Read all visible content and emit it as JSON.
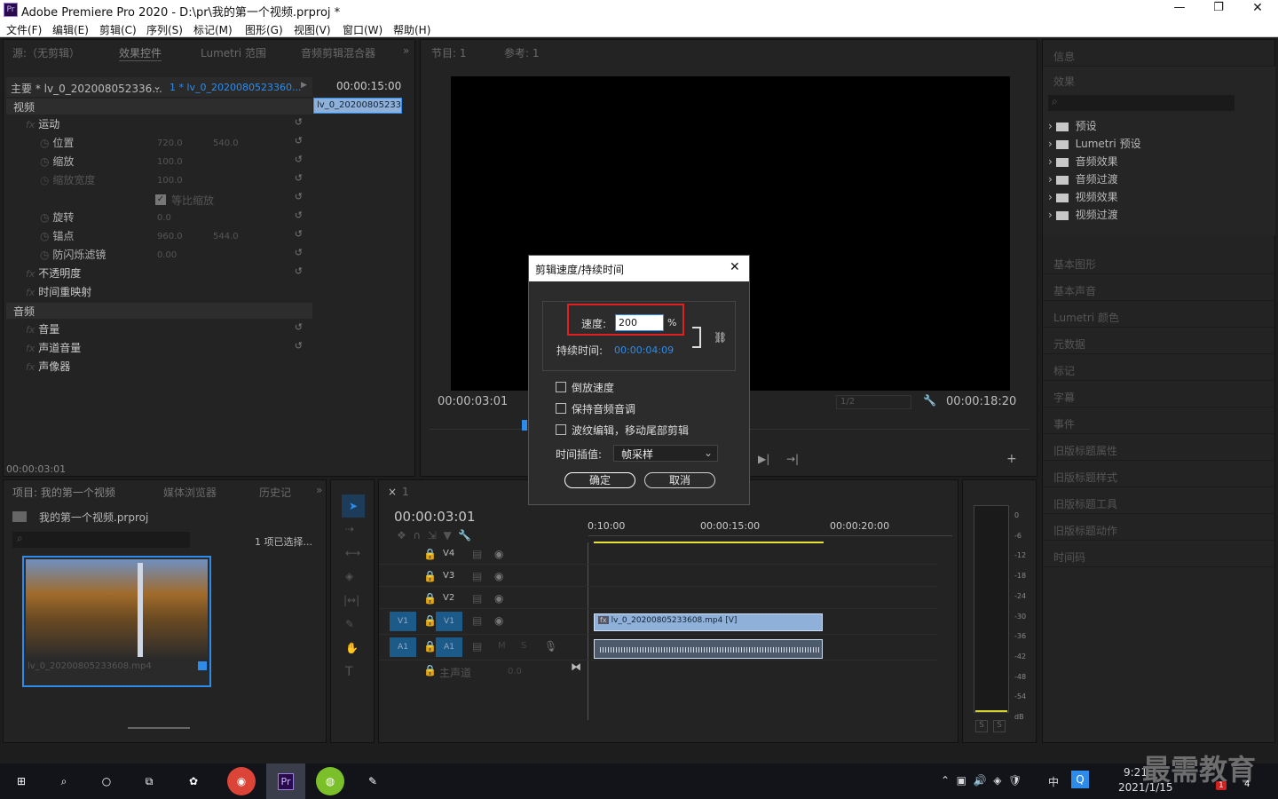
{
  "titlebar": {
    "app_icon": "Pr",
    "title": "Adobe Premiere Pro 2020 - D:\\pr\\我的第一个视频.prproj *",
    "min": "—",
    "max": "❐",
    "close": "✕"
  },
  "menu": [
    "文件(F)",
    "编辑(E)",
    "剪辑(C)",
    "序列(S)",
    "标记(M)",
    "图形(G)",
    "视图(V)",
    "窗口(W)",
    "帮助(H)"
  ],
  "source_panel": {
    "tabs": [
      "源:（无剪辑）",
      "效果控件",
      "Lumetri 范围",
      "音频剪辑混合器"
    ],
    "master": "主要 * lv_0_202008052336...",
    "clip": "1 * lv_0_2020080523360...",
    "timecode": "00:00:15:00",
    "mini_clip": "lv_0_20200805233",
    "section_video": "视频",
    "section_audio": "音频",
    "bottom_timecode": "00:00:03:01",
    "rows": [
      {
        "label": "运动",
        "fx": true,
        "values": [
          "",
          ""
        ]
      },
      {
        "label": "位置",
        "fx": false,
        "values": [
          "720.0",
          "540.0"
        ]
      },
      {
        "label": "缩放",
        "fx": false,
        "values": [
          "100.0",
          ""
        ]
      },
      {
        "label": "缩放宽度",
        "fx": false,
        "values": [
          "100.0",
          ""
        ]
      },
      {
        "label": "等比缩放",
        "fx": false,
        "values": [
          "",
          ""
        ]
      },
      {
        "label": "旋转",
        "fx": false,
        "values": [
          "0.0",
          ""
        ]
      },
      {
        "label": "锚点",
        "fx": false,
        "values": [
          "960.0",
          "544.0"
        ]
      },
      {
        "label": "防闪烁滤镜",
        "fx": false,
        "values": [
          "0.00",
          ""
        ]
      },
      {
        "label": "不透明度",
        "fx": true,
        "values": [
          "",
          ""
        ]
      },
      {
        "label": "时间重映射",
        "fx": true,
        "values": [
          "",
          ""
        ]
      }
    ],
    "audio_rows": [
      "音量",
      "声道音量",
      "声像器"
    ]
  },
  "program_panel": {
    "tabs": [
      "节目: 1",
      "参考: 1"
    ],
    "timecode_left": "00:00:03:01",
    "timecode_right": "00:00:18:20",
    "zoom": "1/2"
  },
  "project_panel": {
    "tabs": [
      "项目: 我的第一个视频",
      "媒体浏览器",
      "历史记"
    ],
    "project_name": "我的第一个视频.prproj",
    "selected_count": "1 项已选择...",
    "thumb_name": "lv_0_20200805233608.mp4"
  },
  "timeline": {
    "tab": "1",
    "timecode": "00:00:03:01",
    "ruler": [
      "0:10:00",
      "00:00:15:00",
      "00:00:20:00"
    ],
    "tracks": [
      "V4",
      "V3",
      "V2",
      "V1",
      "A1"
    ],
    "src_v": "V1",
    "src_a": "A1",
    "master": "主声道",
    "master_val": "0.0",
    "video_clip": "lv_0_20200805233608.mp4 [V]"
  },
  "meter": {
    "scale": [
      "0",
      "-6",
      "-12",
      "-18",
      "-24",
      "-30",
      "-36",
      "-42",
      "-48",
      "-54",
      "dB"
    ],
    "solo": [
      "S",
      "S"
    ]
  },
  "right_panel": {
    "info": "信息",
    "effects": "效果",
    "tree": [
      "预设",
      "Lumetri 预设",
      "音频效果",
      "音频过渡",
      "视频效果",
      "视频过渡"
    ],
    "items": [
      "基本图形",
      "基本声音",
      "Lumetri 颜色",
      "元数据",
      "标记",
      "字幕",
      "事件",
      "旧版标题属性",
      "旧版标题样式",
      "旧版标题工具",
      "旧版标题动作",
      "时间码"
    ]
  },
  "dialog": {
    "title": "剪辑速度/持续时间",
    "speed_label": "速度:",
    "speed_value": "200",
    "speed_unit": "%",
    "duration_label": "持续时间:",
    "duration_value": "00:00:04:09",
    "options": [
      "倒放速度",
      "保持音频音调",
      "波纹编辑，移动尾部剪辑"
    ],
    "interp_label": "时间插值:",
    "interp_value": "帧采样",
    "ok": "确定",
    "cancel": "取消"
  },
  "taskbar": {
    "clock_time": "9:21",
    "clock_date": "2021/1/15",
    "ime": "中",
    "watermark": "最需教育",
    "notif_count": "4",
    "badge": "1"
  },
  "colors": {
    "accent": "#2d8ceb",
    "dialog_highlight": "#e02020",
    "clip_blue": "#8fb0d8",
    "track_blue": "#1c5a8a"
  }
}
